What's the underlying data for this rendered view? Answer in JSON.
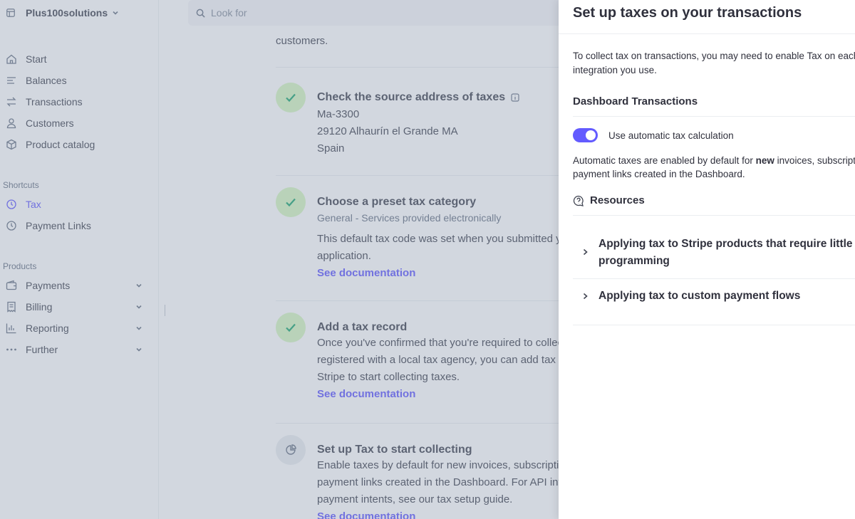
{
  "account": {
    "name": "Plus100solutions"
  },
  "search": {
    "placeholder": "Look for"
  },
  "sidebar": {
    "items": [
      {
        "label": "Start",
        "icon": "home-icon"
      },
      {
        "label": "Balances",
        "icon": "balances-icon"
      },
      {
        "label": "Transactions",
        "icon": "transactions-icon"
      },
      {
        "label": "Customers",
        "icon": "person-icon"
      },
      {
        "label": "Product catalog",
        "icon": "box-icon"
      }
    ],
    "shortcuts_label": "Shortcuts",
    "shortcuts": [
      {
        "label": "Tax",
        "icon": "clock-icon",
        "active": true
      },
      {
        "label": "Payment Links",
        "icon": "clock-icon"
      }
    ],
    "products_label": "Products",
    "products": [
      {
        "label": "Payments",
        "icon": "wallet-icon"
      },
      {
        "label": "Billing",
        "icon": "billing-icon"
      },
      {
        "label": "Reporting",
        "icon": "chart-icon"
      },
      {
        "label": "Further",
        "icon": "more-icon"
      }
    ]
  },
  "main": {
    "top_text": "customers.",
    "steps": [
      {
        "title": "Check the source address of taxes",
        "lines": [
          "Ma-3300",
          "29120 Alhaurín el Grande MA",
          "Spain"
        ]
      },
      {
        "title": "Choose a preset tax category",
        "subtitle": "General - Services provided electronically",
        "lines": [
          "This default tax code was set when you submitted your",
          "application."
        ],
        "link": "See documentation"
      },
      {
        "title": "Add a tax record",
        "lines": [
          "Once you've confirmed that you're required to collect tax and are",
          "registered with a local tax agency, you can add tax records to",
          "Stripe to start collecting taxes."
        ],
        "link": "See documentation"
      },
      {
        "title": "Set up Tax to start collecting",
        "lines": [
          "Enable taxes by default for new invoices, subscriptions, and",
          "payment links created in the Dashboard. For API integrations like",
          "payment intents, see our tax setup guide."
        ],
        "link": "See documentation"
      }
    ]
  },
  "panel": {
    "title": "Set up taxes on your transactions",
    "intro": "To collect tax on transactions, you may need to enable Tax on each payment integration you use.",
    "section_title": "Dashboard Transactions",
    "toggle_label": "Use automatic tax calculation",
    "toggle_on": true,
    "auto_desc_prefix": "Automatic taxes are enabled by default for ",
    "auto_desc_bold": "new",
    "auto_desc_suffix": " invoices, subscriptions, quotes, or payment links created in the Dashboard.",
    "resources_title": "Resources",
    "resources": [
      {
        "label": "Applying tax to Stripe products that require little programming"
      },
      {
        "label": "Applying tax to custom payment flows"
      }
    ]
  },
  "colors": {
    "accent": "#635bff",
    "success_bg": "#d7f7c2",
    "success": "#1ea672"
  }
}
